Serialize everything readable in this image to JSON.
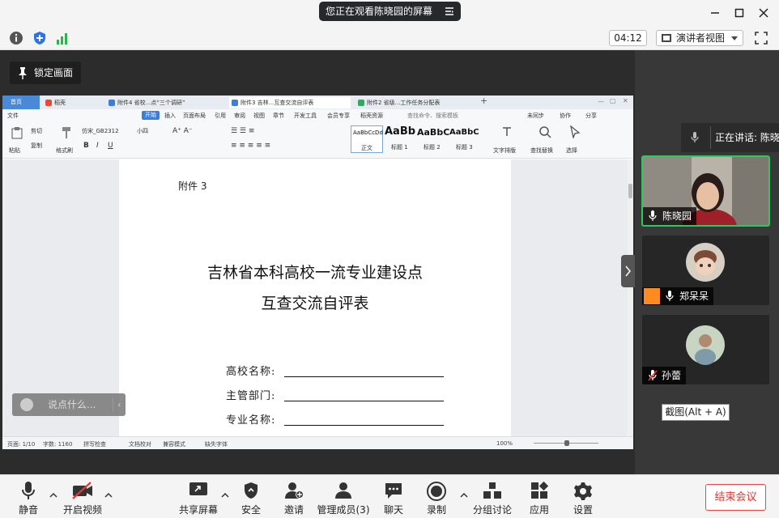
{
  "top_bar": {
    "banner_text": "您正在观看陈晓园的屏幕",
    "window_controls": [
      "minimize-icon",
      "maximize-icon",
      "close-icon"
    ]
  },
  "second_bar": {
    "timer": "04:12",
    "view_mode": "演讲者视图"
  },
  "share_area": {
    "lock_screen_label": "锁定画面",
    "chat_placeholder": "说点什么..."
  },
  "wps": {
    "tabs": [
      {
        "label": "首页",
        "color": "#4a88d8"
      },
      {
        "label": "稻壳",
        "color": "#e34a3a"
      },
      {
        "label": "附件4 省校...点“三个调研”",
        "color": "#3b7ddd"
      },
      {
        "label": "附件3 吉林...互查交流自评表",
        "color": "#3b7ddd"
      },
      {
        "label": "附件2 省级...工作任务分配表",
        "color": "#2daa5f"
      }
    ],
    "ribbon_tabs": [
      "文件",
      "开始",
      "插入",
      "页面布局",
      "引用",
      "审阅",
      "视图",
      "章节",
      "开发工具",
      "会员专享",
      "稻壳资源"
    ],
    "ribbon_search": "查找命令、搜索模板",
    "ribbon_right": [
      "未同步",
      "协作",
      "分享"
    ],
    "ribbon_tools": {
      "cut": "剪切",
      "copy": "复制",
      "paste": "粘贴",
      "format_painter": "格式刷",
      "font_name": "仿宋_GB2312",
      "font_size": "小四",
      "text_layout": "文字排版",
      "find_replace": "查找替换",
      "select": "选择"
    },
    "styles": [
      {
        "preview": "AaBbCcDd",
        "name": "正文"
      },
      {
        "preview": "AaBb",
        "name": "标题 1"
      },
      {
        "preview": "AaBbC",
        "name": "标题 2"
      },
      {
        "preview": "AaBbC",
        "name": "标题 3"
      }
    ],
    "document": {
      "annex": "附件 3",
      "title_line1": "吉林省本科高校一流专业建设点",
      "title_line2": "互查交流自评表",
      "form_rows": [
        "高校名称:",
        "主管部门:",
        "专业名称:"
      ]
    },
    "status_bar": {
      "page": "页面: 1/10",
      "words": "字数: 1160",
      "spell": "拼写检查",
      "proof": "文档校对",
      "compat": "兼容模式",
      "missing_font": "缺失字体",
      "zoom": "100%"
    }
  },
  "participants": {
    "speaking_label": "正在讲话: 陈晓园",
    "tiles": [
      {
        "name": "陈晓园",
        "mic_muted": false
      },
      {
        "name": "郑呆呆",
        "mic_muted": false
      },
      {
        "name": "孙蕾",
        "mic_muted": true
      }
    ],
    "tooltip": "截图(Alt + A)"
  },
  "toolbar": {
    "buttons": [
      {
        "label": "静音",
        "icon": "microphone-icon"
      },
      {
        "label": "开启视频",
        "icon": "camera-off-icon"
      },
      {
        "label": "共享屏幕",
        "icon": "share-screen-icon"
      },
      {
        "label": "安全",
        "icon": "shield-icon"
      },
      {
        "label": "邀请",
        "icon": "invite-icon"
      },
      {
        "label": "管理成员(3)",
        "icon": "members-icon"
      },
      {
        "label": "聊天",
        "icon": "chat-icon"
      },
      {
        "label": "录制",
        "icon": "record-icon"
      },
      {
        "label": "分组讨论",
        "icon": "breakout-icon"
      },
      {
        "label": "应用",
        "icon": "apps-icon"
      },
      {
        "label": "设置",
        "icon": "gear-icon"
      }
    ],
    "end_meeting": "结束会议",
    "end_color": "#e33333"
  }
}
